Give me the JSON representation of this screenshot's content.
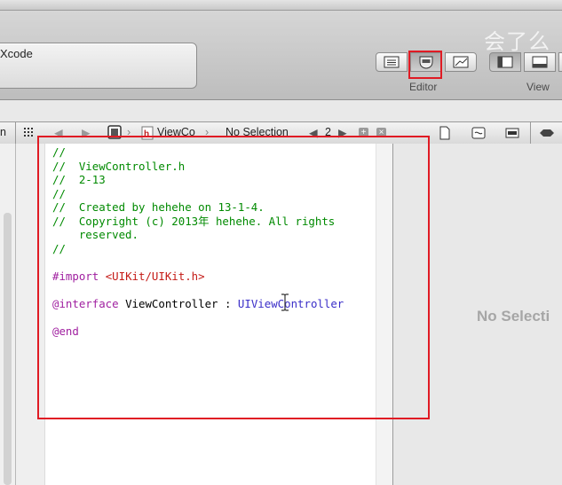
{
  "toolbar": {
    "activity_text": "Xcode",
    "editor_label": "Editor",
    "view_label": "View",
    "watermark": "会了么"
  },
  "jumpbar": {
    "left_fragment": "n",
    "file_crumb": "ViewCo",
    "selection": "No Selection",
    "counterpart_count": "2"
  },
  "editor": {
    "lines": [
      "//",
      "//  ViewController.h",
      "//  2-13",
      "//",
      "//  Created by hehehe on 13-1-4.",
      "//  Copyright (c) 2013年 hehehe. All rights",
      "    reserved.",
      "//",
      "",
      "#import",
      "<UIKit/UIKit.h>",
      "@interface",
      "ViewController : ",
      "UIViewController",
      "@end"
    ]
  },
  "utility": {
    "no_selection": "No Selecti"
  },
  "colors": {
    "comment": "#008a00",
    "keyword": "#a020a0",
    "string": "#c41a16",
    "class": "#3a2ec8",
    "highlight": "#e01b24"
  }
}
